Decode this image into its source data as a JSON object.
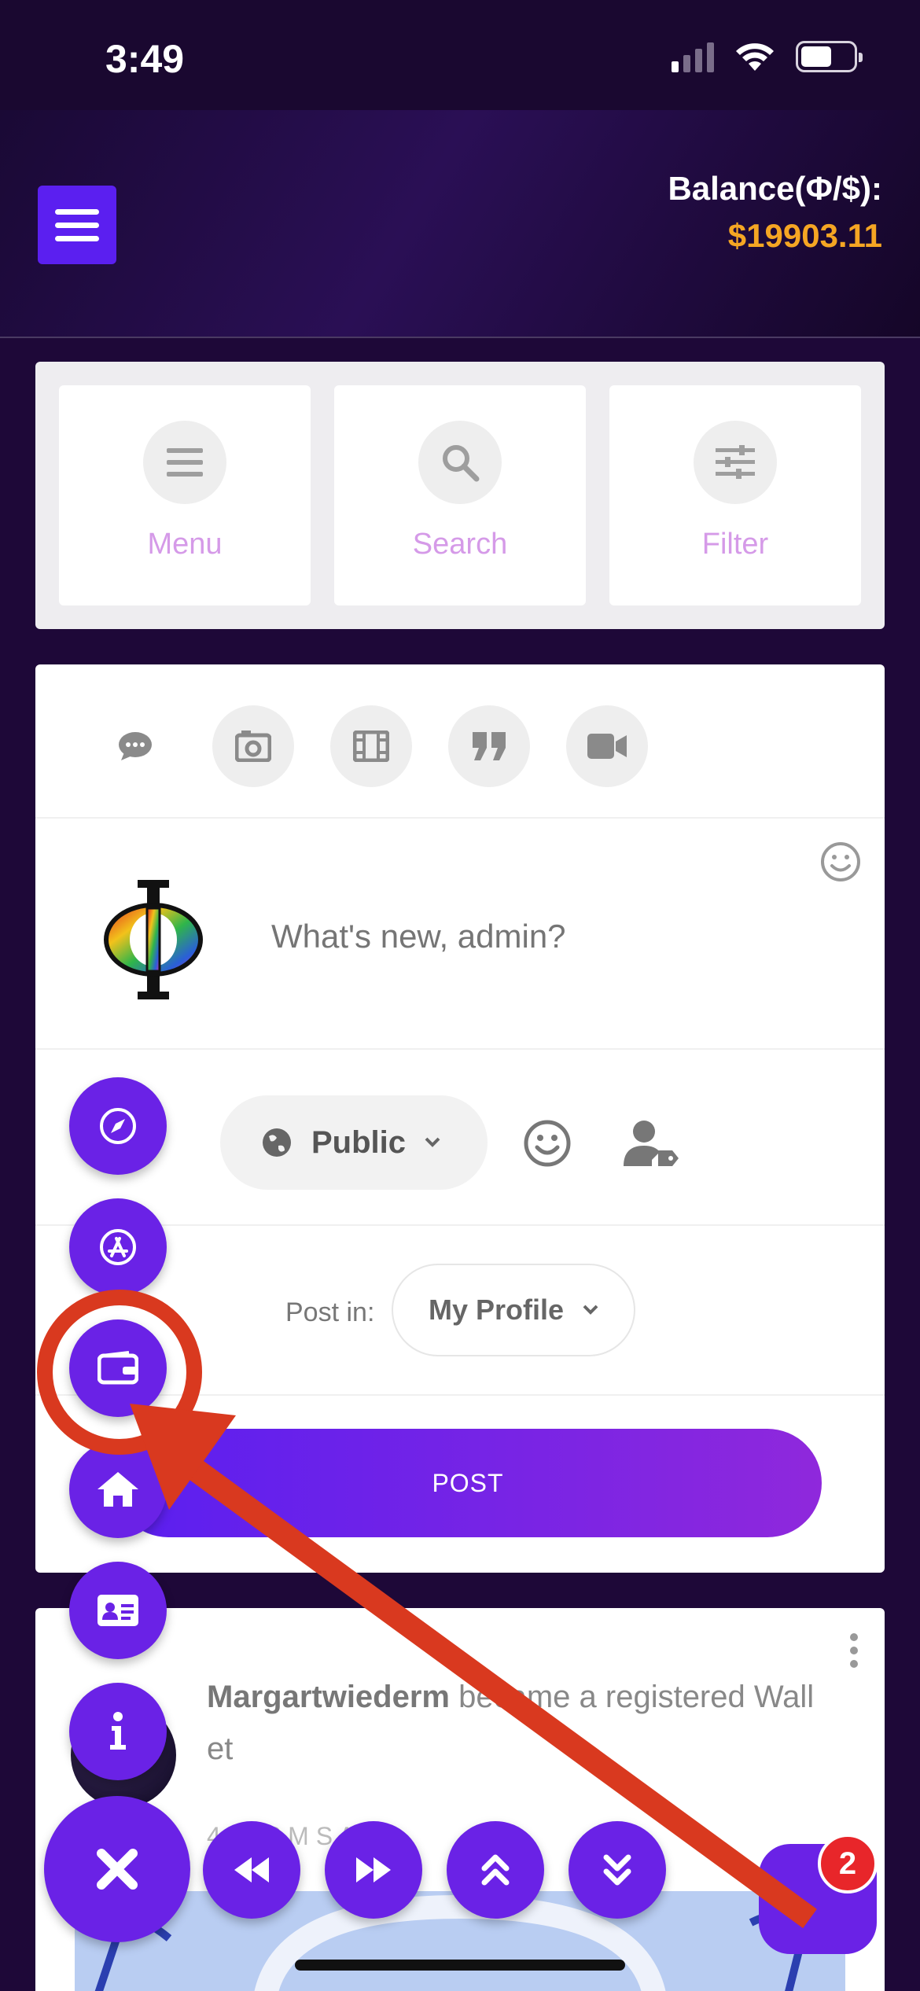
{
  "status_bar": {
    "time": "3:49"
  },
  "header": {
    "balance_label": "Balance(Φ/$):",
    "balance_value": "$19903.11"
  },
  "quick_actions": [
    {
      "label": "Menu",
      "icon": "list-icon"
    },
    {
      "label": "Search",
      "icon": "search-icon"
    },
    {
      "label": "Filter",
      "icon": "sliders-icon"
    }
  ],
  "composer": {
    "post_types": [
      "status-icon",
      "photo-icon",
      "video-icon",
      "quote-icon",
      "live-video-icon"
    ],
    "placeholder": "What's new, admin?",
    "privacy": "Public",
    "post_in_label": "Post in:",
    "post_in_value": "My Profile",
    "post_button": "POST"
  },
  "activity": {
    "name": "Margartwiederm",
    "action": " became a registered Wall et",
    "time": "4 H   28 M   S AG"
  },
  "chat": {
    "badge": "2"
  },
  "colors": {
    "accent": "#6a22e6",
    "balance": "#f5a623",
    "annotation": "#d9391f",
    "quick_label": "#d59ae8"
  }
}
